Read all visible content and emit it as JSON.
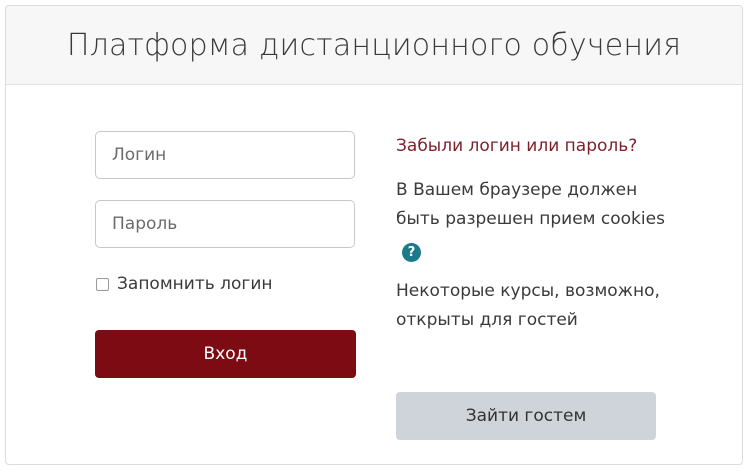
{
  "header": {
    "title": "Платформа дистанционного обучения"
  },
  "login_form": {
    "username_placeholder": "Логин",
    "password_placeholder": "Пароль",
    "remember_label": "Запомнить логин",
    "login_button": "Вход"
  },
  "info": {
    "forgot_link": "Забыли логин или пароль?",
    "cookies_text": "В Вашем браузере должен быть разрешен прием cookies",
    "help_icon": "question-circle-icon",
    "guest_text": "Некоторые курсы, возможно, открыты для гостей",
    "guest_button": "Зайти гостем"
  },
  "colors": {
    "primary": "#7d0b14",
    "link": "#7d1f2a",
    "secondary_button": "#ced4da",
    "help_icon": "#1b7b8b"
  }
}
